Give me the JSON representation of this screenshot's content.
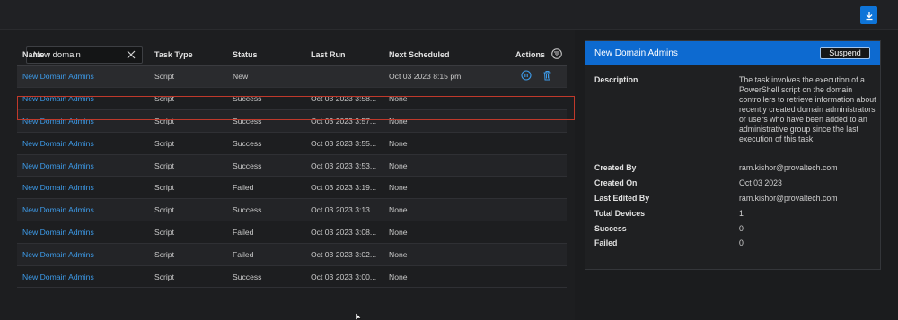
{
  "search": {
    "value": "New domain"
  },
  "table": {
    "headers": [
      "Name ↑",
      "Task Type",
      "Status",
      "Last Run",
      "Next Scheduled",
      "Actions"
    ],
    "rows": [
      {
        "name": "New Domain Admins",
        "type": "Script",
        "status": "New",
        "last_run": "",
        "next": "Oct 03 2023 8:15 pm"
      },
      {
        "name": "New Domain Admins",
        "type": "Script",
        "status": "Success",
        "last_run": "Oct 03 2023 3:58...",
        "next": "None"
      },
      {
        "name": "New Domain Admins",
        "type": "Script",
        "status": "Success",
        "last_run": "Oct 03 2023 3:57...",
        "next": "None"
      },
      {
        "name": "New Domain Admins",
        "type": "Script",
        "status": "Success",
        "last_run": "Oct 03 2023 3:55...",
        "next": "None"
      },
      {
        "name": "New Domain Admins",
        "type": "Script",
        "status": "Success",
        "last_run": "Oct 03 2023 3:53...",
        "next": "None"
      },
      {
        "name": "New Domain Admins",
        "type": "Script",
        "status": "Failed",
        "last_run": "Oct 03 2023 3:19...",
        "next": "None"
      },
      {
        "name": "New Domain Admins",
        "type": "Script",
        "status": "Success",
        "last_run": "Oct 03 2023 3:13...",
        "next": "None"
      },
      {
        "name": "New Domain Admins",
        "type": "Script",
        "status": "Failed",
        "last_run": "Oct 03 2023 3:08...",
        "next": "None"
      },
      {
        "name": "New Domain Admins",
        "type": "Script",
        "status": "Failed",
        "last_run": "Oct 03 2023 3:02...",
        "next": "None"
      },
      {
        "name": "New Domain Admins",
        "type": "Script",
        "status": "Success",
        "last_run": "Oct 03 2023 3:00...",
        "next": "None"
      }
    ]
  },
  "details": {
    "title": "New Domain Admins",
    "suspend_label": "Suspend",
    "description_label": "Description",
    "description": "The task involves the execution of a PowerShell script on the domain controllers to retrieve information about recently created domain administrators or users who have been added to an administrative group since the last execution of this task.",
    "created_by_label": "Created By",
    "created_by": "ram.kishor@provaltech.com",
    "created_on_label": "Created On",
    "created_on": "Oct 03 2023",
    "last_edited_by_label": "Last Edited By",
    "last_edited_by": "ram.kishor@provaltech.com",
    "total_devices_label": "Total Devices",
    "total_devices": "1",
    "success_label": "Success",
    "success": "0",
    "failed_label": "Failed",
    "failed": "0"
  },
  "icons": {
    "download": "download-icon",
    "clear": "close-icon",
    "filter": "filter-icon",
    "pause": "pause-icon",
    "delete": "trash-icon"
  },
  "colors": {
    "accent": "#0d6ad0",
    "link": "#3d9be9",
    "selection_outline": "#c0392b"
  }
}
